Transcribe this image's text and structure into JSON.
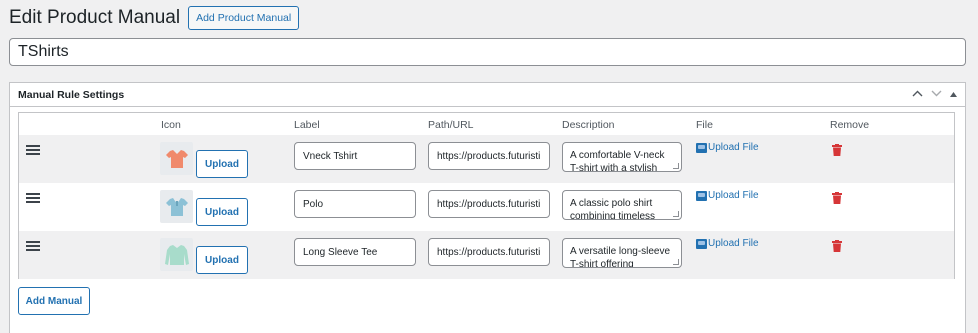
{
  "header": {
    "title": "Edit Product Manual",
    "add_button": "Add Product Manual"
  },
  "post_title": "TShirts",
  "metabox": {
    "title": "Manual Rule Settings",
    "controls": [
      "chevron-up-icon",
      "chevron-down-icon",
      "toggle-arrow-icon"
    ]
  },
  "table": {
    "columns": [
      "Icon",
      "Label",
      "Path/URL",
      "Description",
      "File",
      "Remove"
    ],
    "rows": [
      {
        "icon": "tshirt-orange-icon",
        "icon_color": "#f08a6c",
        "upload_label": "Upload",
        "label": "Vneck Tshirt",
        "path": "https://products.futuristi",
        "description_lines": [
          "A comfortable V-neck",
          "T-shirt with a stylish"
        ],
        "file_label": "Upload File"
      },
      {
        "icon": "polo-blue-icon",
        "icon_color": "#8cc1d6",
        "upload_label": "Upload",
        "label": "Polo",
        "path": "https://products.futuristi",
        "description_lines": [
          "A classic polo shirt",
          "combining timeless"
        ],
        "file_label": "Upload File"
      },
      {
        "icon": "longsleeve-mint-icon",
        "icon_color": "#a8dccb",
        "upload_label": "Upload",
        "label": "Long Sleeve Tee",
        "path": "https://products.futuristi",
        "description_lines": [
          "A versatile long-sleeve",
          "T-shirt offering"
        ],
        "file_label": "Upload File"
      }
    ]
  },
  "add_manual_button": "Add Manual",
  "colors": {
    "accent": "#2271b1",
    "danger": "#d63638",
    "background": "#f0f0f1"
  }
}
